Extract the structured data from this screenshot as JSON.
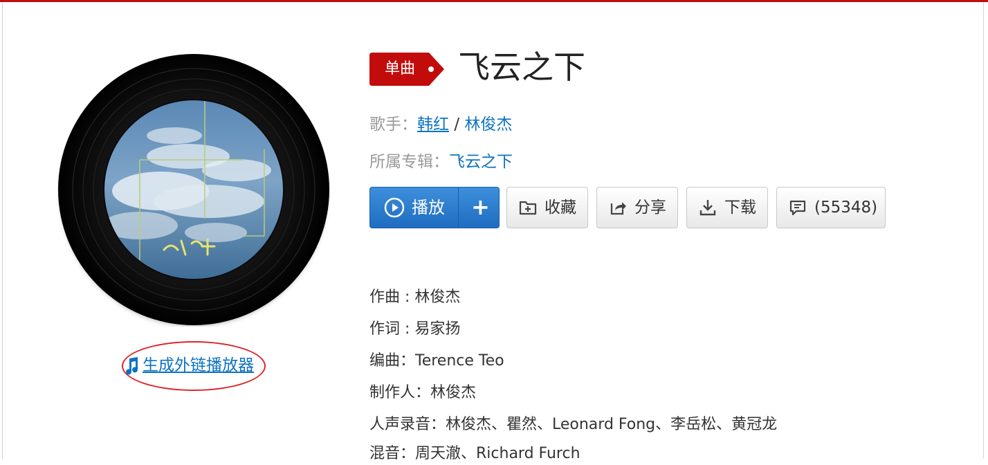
{
  "song": {
    "badge": "单曲",
    "title": "飞云之下"
  },
  "artists": {
    "label": "歌手：",
    "names": [
      "韩红",
      "林俊杰"
    ],
    "separator": "/"
  },
  "album": {
    "label": "所属专辑：",
    "name": "飞云之下"
  },
  "cover": {
    "text": "飞云之下"
  },
  "actions": {
    "play": "播放",
    "add": "+",
    "collect": "收藏",
    "share": "分享",
    "download": "下载",
    "comments": "(55348)"
  },
  "external_player": {
    "label": "生成外链播放器"
  },
  "credits": [
    "作曲 : 林俊杰",
    "作词 : 易家扬",
    "编曲：Terence Teo",
    "制作人：林俊杰",
    "人声录音：林俊杰、瞿然、Leonard Fong、李岳松、黄冠龙",
    "混音：周天澈、Richard Furch"
  ],
  "colors": {
    "accent_red": "#c20c0c",
    "link_blue": "#0c73c2",
    "play_blue": "#2a7bd0"
  },
  "icons": {
    "play": "play-circle-icon",
    "add": "plus-icon",
    "collect": "folder-plus-icon",
    "share": "share-icon",
    "download": "download-icon",
    "comments": "comment-icon",
    "external": "music-note-icon"
  }
}
